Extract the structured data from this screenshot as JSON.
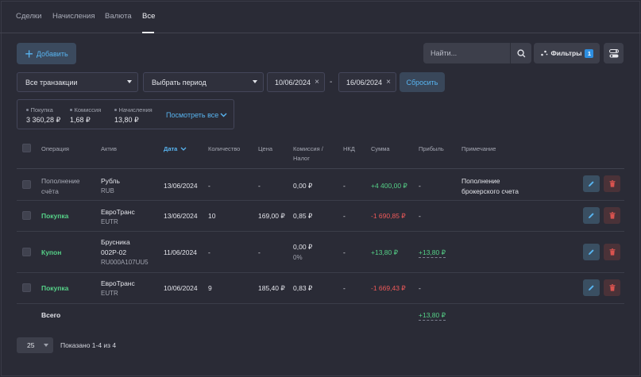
{
  "tabs": [
    {
      "label": "Сделки"
    },
    {
      "label": "Начисления"
    },
    {
      "label": "Валюта"
    },
    {
      "label": "Все"
    }
  ],
  "toolbar": {
    "add_label": "Добавить",
    "search_placeholder": "Найти...",
    "filters_label": "Фильтры",
    "filters_count": "1"
  },
  "filters": {
    "transactions": "Все транзакции",
    "period": "Выбрать период",
    "date_from": "10/06/2024",
    "date_to": "16/06/2024",
    "dash": "-",
    "reset_label": "Сбросить"
  },
  "summary": {
    "items": [
      {
        "caption": "Покупка",
        "value": "3 360,28 ₽"
      },
      {
        "caption": "Комиссия",
        "value": "1,68 ₽"
      },
      {
        "caption": "Начисления",
        "value": "13,80 ₽"
      }
    ],
    "see_all": "Посмотреть все"
  },
  "table": {
    "headers": {
      "operation": "Операция",
      "asset": "Актив",
      "date": "Дата",
      "quantity": "Количество",
      "price": "Цена",
      "commission_1": "Комиссия /",
      "commission_2": "Налог",
      "nkd": "НКД",
      "sum": "Сумма",
      "profit": "Прибыль",
      "note": "Примечание"
    },
    "rows": [
      {
        "operation_1": "Пополнение",
        "operation_2": "счёта",
        "asset_1": "Рубль",
        "asset_2": "RUB",
        "date": "13/06/2024",
        "quantity": "-",
        "price": "-",
        "commission": "0,00 ₽",
        "nkd": "-",
        "sum": "+4 400,00 ₽",
        "profit": "-",
        "note_1": "Пополнение",
        "note_2": "брокерского счета"
      },
      {
        "operation": "Покупка",
        "asset_1": "ЕвроТранс",
        "asset_2": "EUTR",
        "date": "13/06/2024",
        "quantity": "10",
        "price": "169,00 ₽",
        "commission": "0,85 ₽",
        "nkd": "-",
        "sum": "-1 690,85 ₽",
        "profit": "-"
      },
      {
        "operation": "Купон",
        "asset_1": "Брусника",
        "asset_2": "002P-02",
        "asset_3": "RU000A107UU5",
        "date": "11/06/2024",
        "quantity": "-",
        "price": "-",
        "commission": "0,00 ₽",
        "commission_sub": "0%",
        "nkd": "-",
        "sum": "+13,80 ₽",
        "profit": "+13,80 ₽"
      },
      {
        "operation": "Покупка",
        "asset_1": "ЕвроТранс",
        "asset_2": "EUTR",
        "date": "10/06/2024",
        "quantity": "9",
        "price": "185,40 ₽",
        "commission": "0,83 ₽",
        "nkd": "-",
        "sum": "-1 669,43 ₽",
        "profit": "-"
      }
    ],
    "total_label": "Всего",
    "total_profit": "+13,80 ₽"
  },
  "footer": {
    "page_size": "25",
    "shown": "Показано 1-4 из 4"
  },
  "colors": {
    "accent": "#58b4f0",
    "positive": "#55d087",
    "negative": "#ef5a5a",
    "background": "#2a2b36"
  }
}
